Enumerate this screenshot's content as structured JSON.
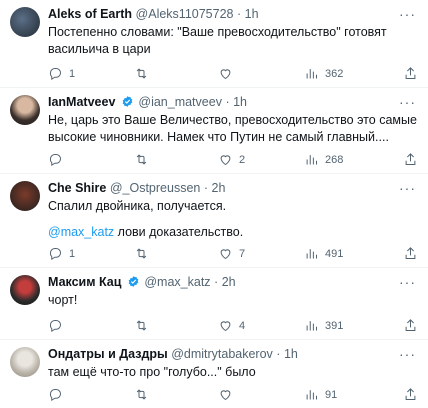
{
  "tweets": [
    {
      "name": "Aleks of Earth",
      "handle": "@Aleks11075728",
      "time": "1h",
      "text": "Постепенно словами: \"Ваше превосходительство\" готовят васильича в цари",
      "replies": "1",
      "retweets": "",
      "likes": "",
      "views": "362"
    },
    {
      "name": "IanMatveev",
      "handle": "@ian_matveev",
      "time": "1h",
      "text": "Не, царь это Ваше Величество, превосходительство это самые высокие чиновники. Намек что Путин не самый главный....",
      "replies": "",
      "retweets": "",
      "likes": "2",
      "views": "268"
    },
    {
      "name": "Che Shire",
      "handle": "@_Ostpreussen",
      "time": "2h",
      "text": "Спалил двойника, получается.",
      "mention": "@max_katz",
      "text2": " лови доказательство.",
      "replies": "1",
      "retweets": "",
      "likes": "7",
      "views": "491"
    },
    {
      "name": "Максим Кац",
      "handle": "@max_katz",
      "time": "2h",
      "text": "чорт!",
      "replies": "",
      "retweets": "",
      "likes": "4",
      "views": "391"
    },
    {
      "name": "Ондатры и Даздры",
      "handle": "@dmitrytabakerov",
      "time": "1h",
      "text": "там ещё что-то про \"голубо...\" было",
      "replies": "",
      "retweets": "",
      "likes": "",
      "views": "91"
    }
  ],
  "dot": "·",
  "more": "···",
  "colors": {
    "accent": "#1d9bf0",
    "muted": "#536471",
    "text": "#0f1419"
  }
}
